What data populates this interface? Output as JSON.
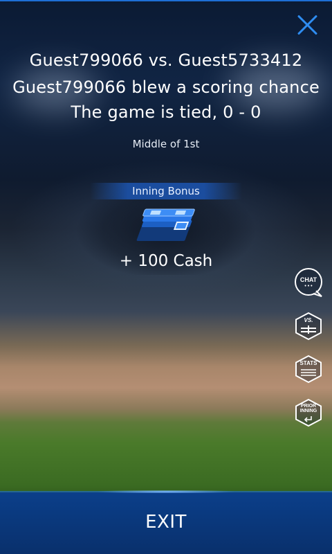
{
  "matchup": "Guest799066 vs. Guest5733412",
  "play_result": "Guest799066 blew a scoring chance",
  "score_status": "The game is tied, 0 - 0",
  "inning_status": "Middle of 1st",
  "bonus": {
    "title": "Inning Bonus",
    "amount": "+ 100 Cash",
    "icon": "cash-stack-icon"
  },
  "side_buttons": {
    "chat": "CHAT",
    "chat_dots": "• • •",
    "vs": "VS.",
    "stats": "STATS",
    "prior_line1": "PRIOR",
    "prior_line2": "INNING"
  },
  "exit_label": "EXIT",
  "colors": {
    "accent": "#2e8cf0",
    "exit_bar": "#0b3f8a",
    "bonus_tag": "#1b4d9e"
  }
}
